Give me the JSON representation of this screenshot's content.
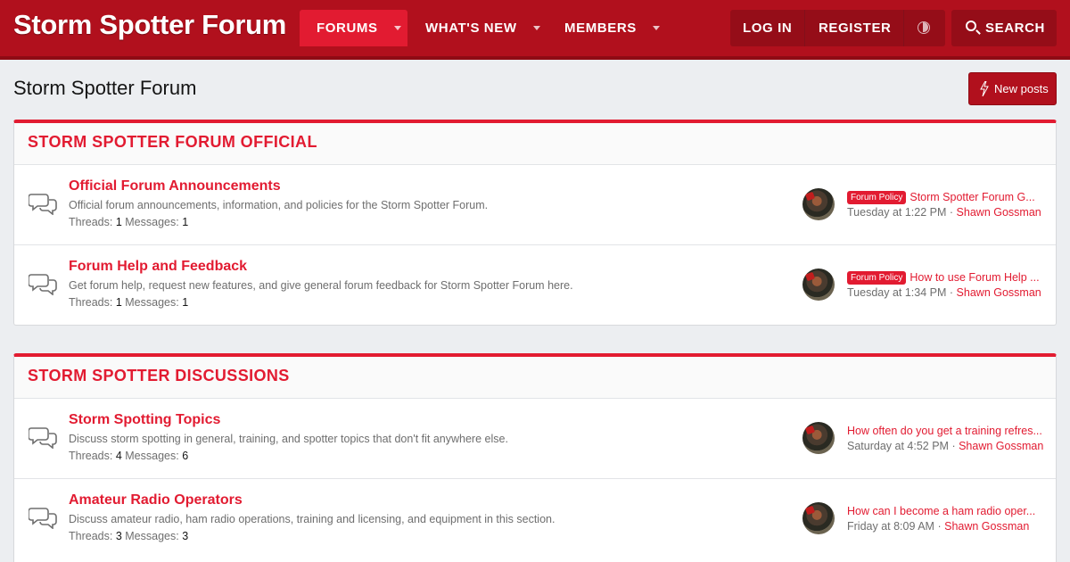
{
  "header": {
    "logo": "Storm Spotter Forum",
    "nav": [
      {
        "label": "FORUMS",
        "active": true
      },
      {
        "label": "WHAT'S NEW",
        "active": false
      },
      {
        "label": "MEMBERS",
        "active": false
      }
    ],
    "login_label": "LOG IN",
    "register_label": "REGISTER",
    "search_label": "SEARCH"
  },
  "page": {
    "title": "Storm Spotter Forum",
    "new_posts_label": "New posts"
  },
  "categories": [
    {
      "title": "STORM SPOTTER FORUM OFFICIAL",
      "nodes": [
        {
          "title": "Official Forum Announcements",
          "description": "Official forum announcements, information, and policies for the Storm Spotter Forum.",
          "threads_label": "Threads:",
          "threads": "1",
          "messages_label": "Messages:",
          "messages": "1",
          "last_prefix": "Forum Policy",
          "last_thread": "Storm Spotter Forum G...",
          "last_time": "Tuesday at 1:22 PM",
          "last_sep": "·",
          "last_user": "Shawn Gossman"
        },
        {
          "title": "Forum Help and Feedback",
          "description": "Get forum help, request new features, and give general forum feedback for Storm Spotter Forum here.",
          "threads_label": "Threads:",
          "threads": "1",
          "messages_label": "Messages:",
          "messages": "1",
          "last_prefix": "Forum Policy",
          "last_thread": "How to use Forum Help ...",
          "last_time": "Tuesday at 1:34 PM",
          "last_sep": "·",
          "last_user": "Shawn Gossman"
        }
      ]
    },
    {
      "title": "STORM SPOTTER DISCUSSIONS",
      "nodes": [
        {
          "title": "Storm Spotting Topics",
          "description": "Discuss storm spotting in general, training, and spotter topics that don't fit anywhere else.",
          "threads_label": "Threads:",
          "threads": "4",
          "messages_label": "Messages:",
          "messages": "6",
          "last_thread": "How often do you get a training refres...",
          "last_time": "Saturday at 4:52 PM",
          "last_sep": "·",
          "last_user": "Shawn Gossman"
        },
        {
          "title": "Amateur Radio Operators",
          "description": "Discuss amateur radio, ham radio operations, training and licensing, and equipment in this section.",
          "threads_label": "Threads:",
          "threads": "3",
          "messages_label": "Messages:",
          "messages": "3",
          "last_thread": "How can I become a ham radio oper...",
          "last_time": "Friday at 8:09 AM",
          "last_sep": "·",
          "last_user": "Shawn Gossman"
        }
      ]
    }
  ],
  "colors": {
    "header_bg": "#b1101d",
    "accent": "#e21b31",
    "page_bg": "#eceef1"
  },
  "icons": [
    "moon-toggle-icon",
    "search-icon",
    "bolt-icon",
    "chat-bubbles-icon",
    "chevron-down-icon"
  ]
}
